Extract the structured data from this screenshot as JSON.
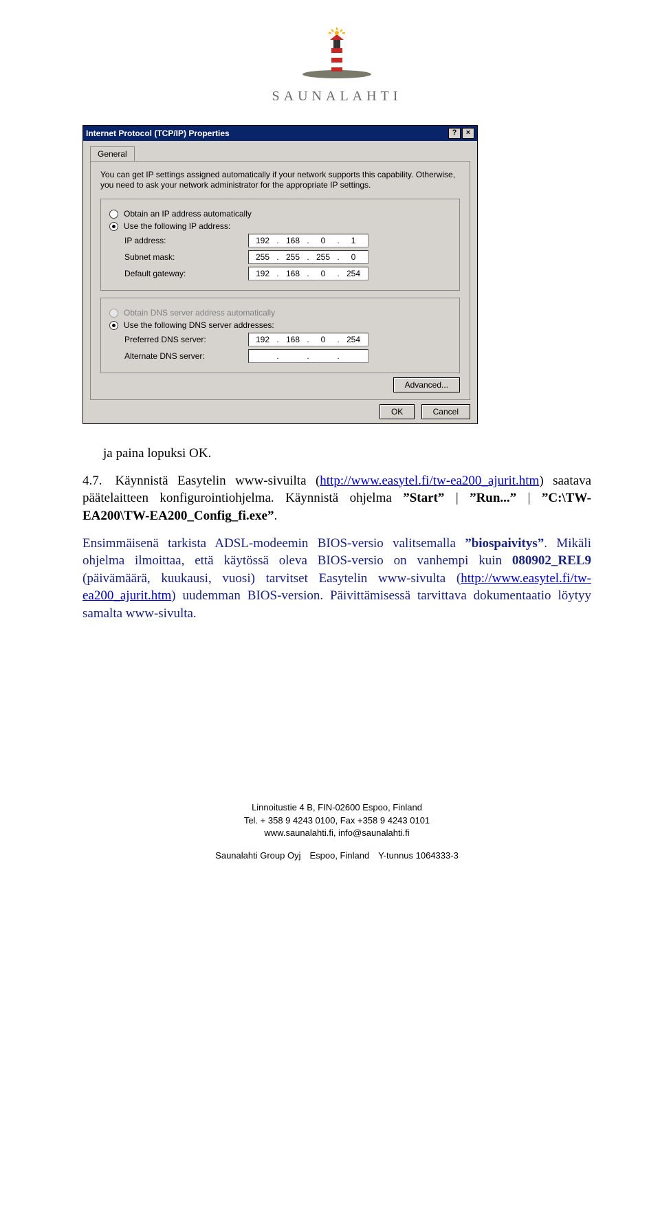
{
  "logo": {
    "brand": "SAUNALAHTI"
  },
  "dialog": {
    "title": "Internet Protocol (TCP/IP) Properties",
    "help_btn": "?",
    "close_btn": "×",
    "tab": "General",
    "description": "You can get IP settings assigned automatically if your network supports this capability. Otherwise, you need to ask your network administrator for the appropriate IP settings.",
    "opt_auto_ip": "Obtain an IP address automatically",
    "opt_use_ip": "Use the following IP address:",
    "lbl_ip": "IP address:",
    "lbl_mask": "Subnet mask:",
    "lbl_gw": "Default gateway:",
    "ip": {
      "a": "192",
      "b": "168",
      "c": "0",
      "d": "1"
    },
    "mask": {
      "a": "255",
      "b": "255",
      "c": "255",
      "d": "0"
    },
    "gw": {
      "a": "192",
      "b": "168",
      "c": "0",
      "d": "254"
    },
    "opt_auto_dns": "Obtain DNS server address automatically",
    "opt_use_dns": "Use the following DNS server addresses:",
    "lbl_dns1": "Preferred DNS server:",
    "lbl_dns2": "Alternate DNS server:",
    "dns1": {
      "a": "192",
      "b": "168",
      "c": "0",
      "d": "254"
    },
    "dns2": {
      "a": "",
      "b": "",
      "c": "",
      "d": ""
    },
    "btn_adv": "Advanced...",
    "btn_ok": "OK",
    "btn_cancel": "Cancel"
  },
  "body": {
    "p1": "ja paina lopuksi OK.",
    "p2_lead": "4.7. Käynnistä Easytelin www-sivuilta (",
    "p2_link": "http://www.easytel.fi/tw-ea200_ajurit.htm",
    "p2_tail": ") saatava päätelaitteen konfigurointiohjelma. Käynnistä ohjelma ",
    "p2_b1": "”Start”",
    "p2_pipe1": " | ",
    "p2_b2": "”Run...”",
    "p2_pipe2": " | ",
    "p2_b3": "”C:\\TW-EA200\\TW-EA200_Config_fi.exe”",
    "p2_end": ".",
    "p3a": "Ensimmäisenä tarkista ADSL-modeemin BIOS-versio valitsemalla ",
    "p3b": "”biospaivitys”",
    "p3c": ". Mikäli ohjelma ilmoittaa, että käytössä oleva BIOS-versio on vanhempi kuin ",
    "p3d": "080902_REL9",
    "p3e": " (päivämäärä, kuukausi, vuosi) tarvitset Easytelin www-sivulta (",
    "p3link": "http://www.easytel.fi/tw-ea200_ajurit.htm",
    "p3f": ") uudemman BIOS-version. Päivittämisessä tarvittava dokumentaatio löytyy samalta www-sivulta."
  },
  "footer": {
    "l1": "Linnoitustie 4 B, FIN-02600 Espoo, Finland",
    "l2": "Tel. + 358 9 4243 0100, Fax +358 9 4243 0101",
    "l3": "www.saunalahti.fi, info@saunalahti.fi",
    "l4": "Saunalahti Group Oyj Espoo, Finland Y-tunnus 1064333-3"
  }
}
